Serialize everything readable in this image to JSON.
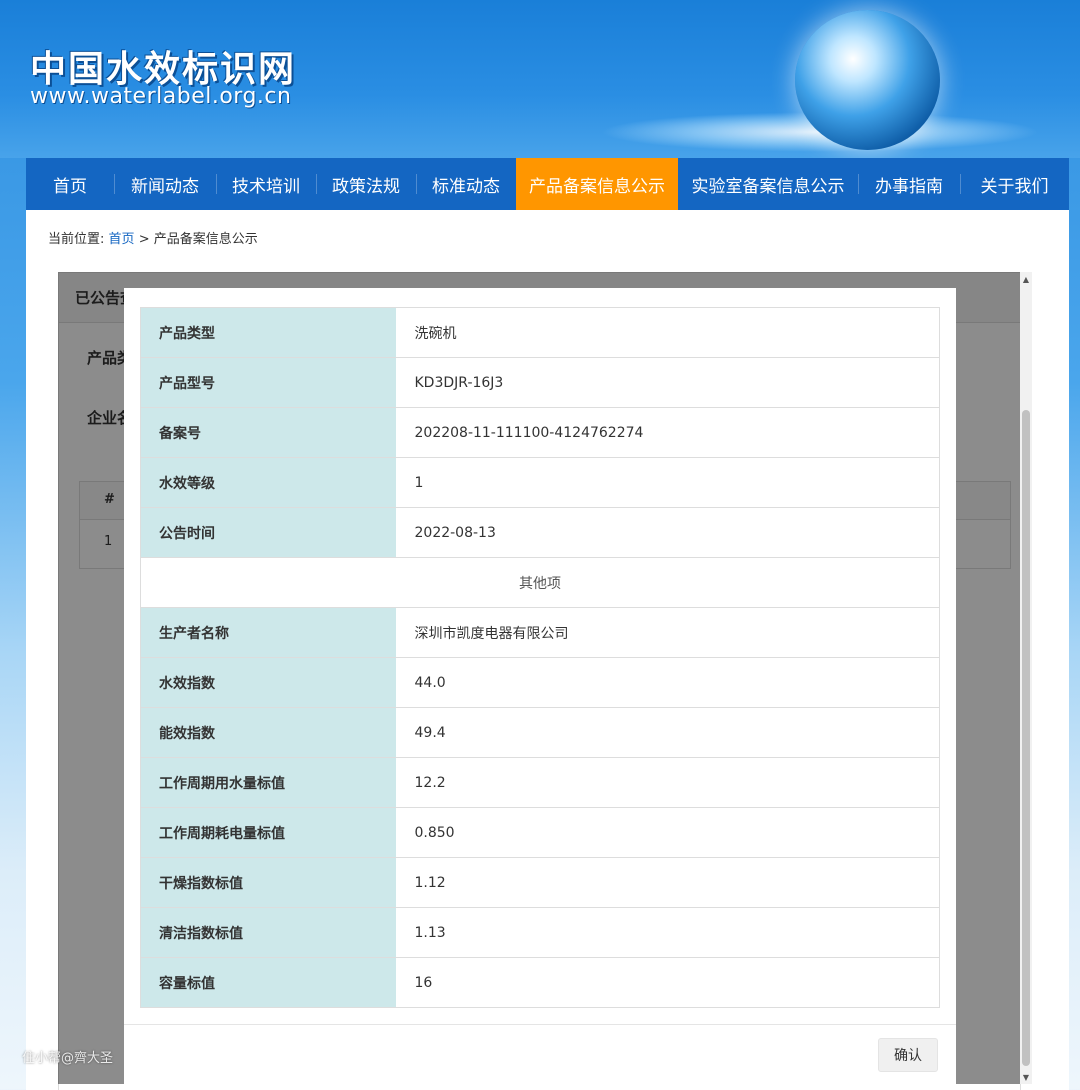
{
  "site": {
    "title": "中国水效标识网",
    "url": "www.waterlabel.org.cn"
  },
  "nav": {
    "items": [
      {
        "label": "首页",
        "active": false
      },
      {
        "label": "新闻动态",
        "active": false
      },
      {
        "label": "技术培训",
        "active": false
      },
      {
        "label": "政策法规",
        "active": false
      },
      {
        "label": "标准动态",
        "active": false
      },
      {
        "label": "产品备案信息公示",
        "active": true
      },
      {
        "label": "实验室备案信息公示",
        "active": false
      },
      {
        "label": "办事指南",
        "active": false
      },
      {
        "label": "关于我们",
        "active": false
      }
    ]
  },
  "breadcrumb": {
    "prefix": "当前位置:",
    "home": "首页",
    "separator": ">",
    "current": "产品备案信息公示"
  },
  "underlying": {
    "card_title": "已公告查",
    "label_product": "产品类",
    "label_company": "企业名",
    "table_header_index": "#",
    "table_row_index": "1"
  },
  "modal": {
    "rows": [
      {
        "key": "产品类型",
        "value": "洗碗机"
      },
      {
        "key": "产品型号",
        "value": "KD3DJR-16J3"
      },
      {
        "key": "备案号",
        "value": "202208-11-111100-4124762274"
      },
      {
        "key": "水效等级",
        "value": "1"
      },
      {
        "key": "公告时间",
        "value": "2022-08-13"
      }
    ],
    "section_title": "其他项",
    "other_rows": [
      {
        "key": "生产者名称",
        "value": "深圳市凯度电器有限公司"
      },
      {
        "key": "水效指数",
        "value": "44.0"
      },
      {
        "key": "能效指数",
        "value": "49.4"
      },
      {
        "key": "工作周期用水量标值",
        "value": "12.2"
      },
      {
        "key": "工作周期耗电量标值",
        "value": "0.850"
      },
      {
        "key": "干燥指数标值",
        "value": "1.12"
      },
      {
        "key": "清洁指数标值",
        "value": "1.13"
      },
      {
        "key": "容量标值",
        "value": "16"
      }
    ],
    "confirm_label": "确认"
  },
  "watermark": "住小帮@齊大圣",
  "colors": {
    "nav_bg": "#1466c2",
    "nav_active": "#ff9600",
    "key_cell_bg": "#cde8ea"
  }
}
